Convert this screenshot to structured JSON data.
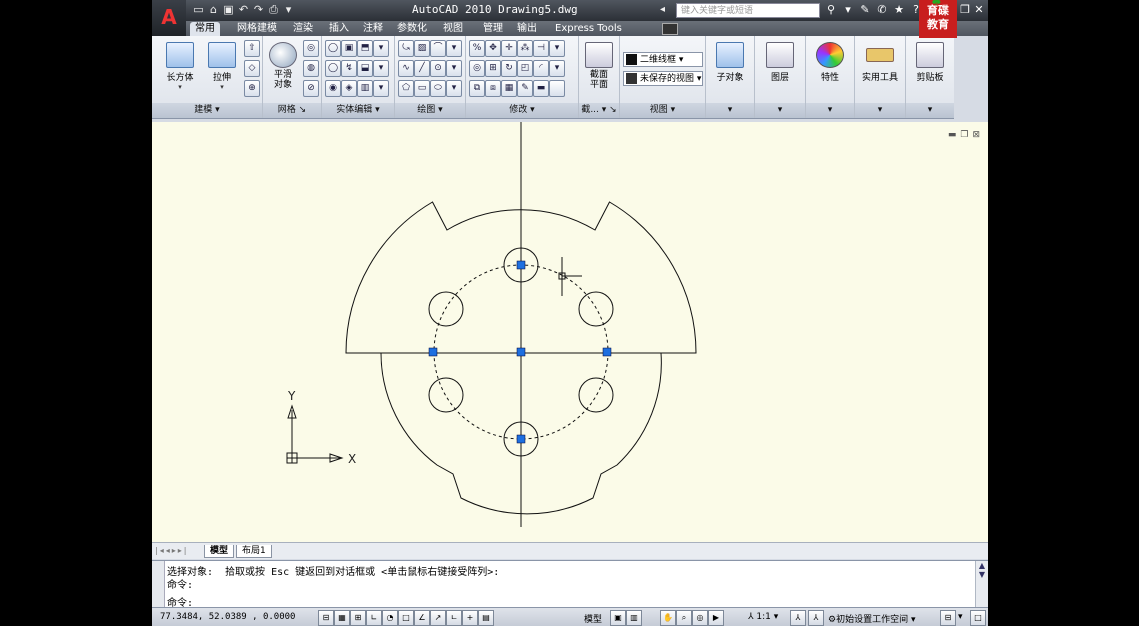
{
  "window": {
    "title": "AutoCAD 2010   Drawing5.dwg",
    "search_placeholder": "键入关键字或短语",
    "logo_text": [
      "育碟",
      "教育"
    ]
  },
  "tabs": [
    "常用",
    "网格建模",
    "渲染",
    "插入",
    "注释",
    "参数化",
    "视图",
    "管理",
    "输出",
    "Express Tools"
  ],
  "active_tab": "常用",
  "ribbon": {
    "modeling": {
      "box_label": "长方体",
      "extrude_label": "拉伸",
      "panel": "建模"
    },
    "mesh": {
      "smooth_label": "平滑\n对象",
      "panel": "网格"
    },
    "solid_edit": {
      "panel": "实体编辑"
    },
    "draw": {
      "panel": "绘图"
    },
    "modify": {
      "panel": "修改"
    },
    "section": {
      "label": "截面\n平面",
      "panel": "截..."
    },
    "view": {
      "visual_style": "二维线框",
      "saved_view": "未保存的视图",
      "panel": "视图"
    },
    "subobject_label": "子对象",
    "layers_label": "图层",
    "properties_label": "特性",
    "utilities_label": "实用工具",
    "clipboard_label": "剪贴板"
  },
  "drawing": {
    "ucs_x": "X",
    "ucs_y": "Y",
    "layout_tabs": [
      "模型",
      "布局1"
    ]
  },
  "command": {
    "line1": "选择对象:  拾取或按 Esc 键返回到对话框或 <单击鼠标右键接受阵列>:",
    "line2": "命令:",
    "prompt": "命令:"
  },
  "status": {
    "coordinates": "77.3484,  52.0389 , 0.0000",
    "model_label": "模型",
    "scale": "1:1",
    "workspace": "初始设置工作空间"
  }
}
